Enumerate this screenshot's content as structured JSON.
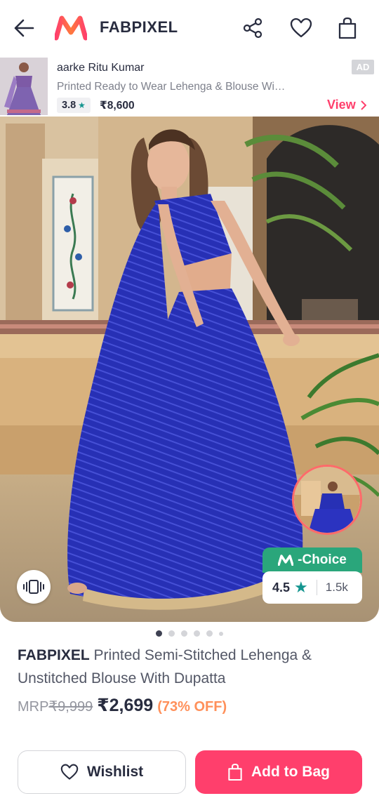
{
  "header": {
    "brand_title": "FABPIXEL"
  },
  "ad": {
    "brand": "aarke Ritu Kumar",
    "description": "Printed Ready to Wear Lehenga & Blouse Wi…",
    "rating": "3.8",
    "price": "₹8,600",
    "badge": "AD",
    "view_label": "View"
  },
  "hero": {
    "mchoice_label": "-Choice",
    "rating": "4.5",
    "rating_count": "1.5k",
    "carousel_pages": 6,
    "carousel_active": 1
  },
  "product": {
    "brand": "FABPIXEL",
    "name": " Printed Semi-Stitched Lehenga & Unstitched Blouse With Dupatta",
    "mrp_label": "MRP",
    "mrp_value": "₹9,999",
    "price": "₹2,699",
    "discount": "(73% OFF)"
  },
  "actions": {
    "wishlist_label": "Wishlist",
    "add_to_bag_label": "Add to Bag"
  },
  "colors": {
    "accent": "#ff3f6c",
    "rating_star": "#14958f",
    "mchoice_green": "#2aa67b",
    "discount": "#ff905a",
    "dress_blue": "#2b2fb8"
  }
}
